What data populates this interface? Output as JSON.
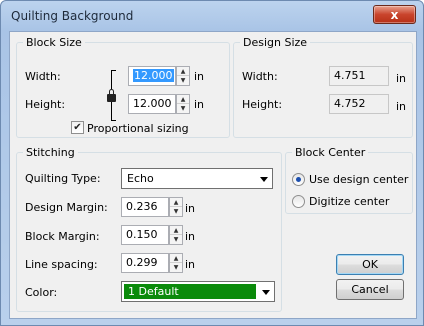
{
  "window": {
    "title": "Quilting Background",
    "close_glyph": "x"
  },
  "block_size": {
    "label": "Block Size",
    "width_label": "Width:",
    "width_value": "12.000",
    "height_label": "Height:",
    "height_value": "12.000",
    "unit": "in",
    "proportional_label": "Proportional sizing",
    "proportional_checked": true
  },
  "design_size": {
    "label": "Design Size",
    "width_label": "Width:",
    "width_value": "4.751",
    "height_label": "Height:",
    "height_value": "4.752",
    "unit": "in"
  },
  "stitching": {
    "label": "Stitching",
    "quilting_type_label": "Quilting Type:",
    "quilting_type_value": "Echo",
    "design_margin_label": "Design Margin:",
    "design_margin_value": "0.236",
    "block_margin_label": "Block Margin:",
    "block_margin_value": "0.150",
    "line_spacing_label": "Line spacing:",
    "line_spacing_value": "0.299",
    "unit": "in",
    "color_label": "Color:",
    "color_value": "1 Default",
    "color_swatch": "#0a8a0a"
  },
  "block_center": {
    "label": "Block Center",
    "use_design_center": "Use design center",
    "digitize_center": "Digitize center",
    "selected": "use_design_center"
  },
  "buttons": {
    "ok": "OK",
    "cancel": "Cancel"
  },
  "colors": {
    "titlebar": "#b9d0ec",
    "close": "#c9442c",
    "selection": "#3399ff"
  }
}
